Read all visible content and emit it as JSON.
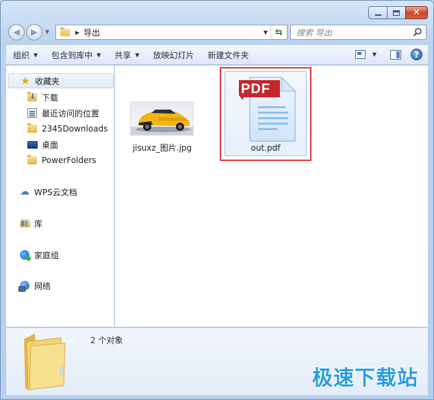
{
  "window": {
    "caption_buttons": {
      "minimize": "minimize",
      "maximize": "maximize",
      "close": "✕"
    }
  },
  "address_bar": {
    "path": [
      "导出"
    ],
    "refresh_icon": "refresh-icon"
  },
  "search": {
    "placeholder": "搜索 导出"
  },
  "toolbar": {
    "items": [
      {
        "label": "组织",
        "has_dropdown": true
      },
      {
        "label": "包含到库中",
        "has_dropdown": true
      },
      {
        "label": "共享",
        "has_dropdown": true
      },
      {
        "label": "放映幻灯片",
        "has_dropdown": false
      },
      {
        "label": "新建文件夹",
        "has_dropdown": false
      }
    ],
    "help_label": "?"
  },
  "navpane": {
    "favorites_label": "收藏夹",
    "favorites": [
      {
        "label": "下载",
        "icon": "download-folder-icon"
      },
      {
        "label": "最近访问的位置",
        "icon": "recent-places-icon"
      },
      {
        "label": "2345Downloads",
        "icon": "folder-icon"
      },
      {
        "label": "桌面",
        "icon": "desktop-icon"
      },
      {
        "label": "PowerFolders",
        "icon": "folder-icon"
      }
    ],
    "wps_label": "WPS云文档",
    "libraries_label": "库",
    "homegroup_label": "家庭组",
    "network_label": "网络"
  },
  "files": [
    {
      "name": "jisuxz_图片.jpg",
      "type": "image"
    },
    {
      "name": "out.pdf",
      "type": "pdf",
      "badge": "PDF",
      "highlighted": true
    }
  ],
  "details": {
    "status": "2 个对象"
  },
  "watermark": "极速下载站",
  "colors": {
    "highlight_frame": "#d8383d",
    "pdf_red": "#c8252b",
    "watermark": "#2a9ce0"
  }
}
